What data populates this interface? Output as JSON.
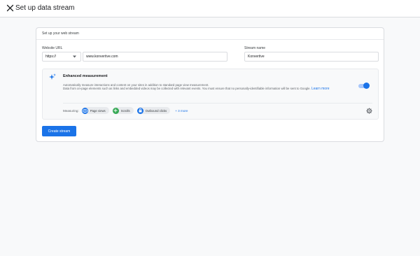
{
  "header": {
    "title": "Set up data stream"
  },
  "card": {
    "title": "Set up your web stream",
    "website_url_label": "Website URL",
    "protocol_value": "https://",
    "url_value": "www.konvertive.com",
    "stream_name_label": "Stream name",
    "stream_name_value": "Konvertive"
  },
  "enhanced_measurement": {
    "title": "Enhanced measurement",
    "description_line1": "Automatically measure interactions and content on your sites in addition to standard page view measurement.",
    "description_line2": "Data from on-page elements such as links and embedded videos may be collected with relevant events. You must ensure that no personally-identifiable information will be sent to Google.",
    "learn_more": "Learn more",
    "toggle_on": true,
    "measuring_label": "Measuring:",
    "chips": [
      {
        "label": "Page views",
        "color": "#1a73e8",
        "icon": "eye-icon"
      },
      {
        "label": "Scrolls",
        "color": "#34a853",
        "icon": "scroll-arrows-icon"
      },
      {
        "label": "Outbound clicks",
        "color": "#1a73e8",
        "icon": "lock-icon"
      }
    ],
    "more_link": "+ 3 more"
  },
  "actions": {
    "create_stream": "Create stream"
  },
  "colors": {
    "accent": "#1a73e8",
    "background": "#f8f9fa"
  }
}
